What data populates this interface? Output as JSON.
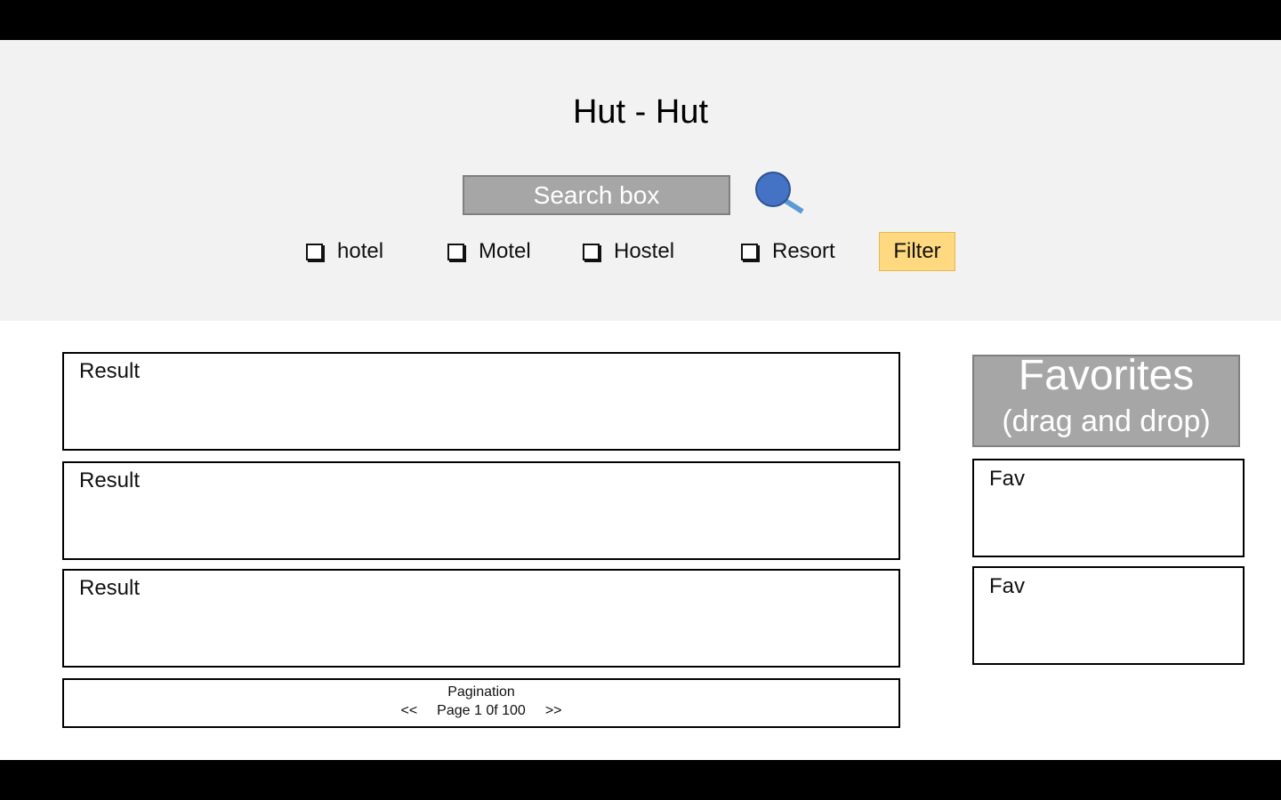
{
  "app": {
    "title": "Hut - Hut"
  },
  "search": {
    "placeholder": "Search box",
    "value": ""
  },
  "filters": [
    {
      "label": "hotel",
      "checked": false
    },
    {
      "label": "Motel",
      "checked": false
    },
    {
      "label": "Hostel",
      "checked": false
    },
    {
      "label": "Resort",
      "checked": false
    }
  ],
  "filter_button": {
    "label": "Filter"
  },
  "results": [
    {
      "label": "Result"
    },
    {
      "label": "Result"
    },
    {
      "label": "Result"
    }
  ],
  "pagination": {
    "label": "Pagination",
    "prev": "<<",
    "page_text": "Page 1 0f 100",
    "next": ">>"
  },
  "favorites": {
    "title": "Favorites",
    "subtitle": "(drag and drop)",
    "items": [
      {
        "label": "Fav"
      },
      {
        "label": "Fav"
      }
    ]
  },
  "icons": {
    "search": "search-icon",
    "checkbox": "checkbox-icon"
  },
  "colors": {
    "header_bg": "#f2f2f2",
    "search_bg": "#a6a6a6",
    "search_icon": "#4472c4",
    "search_handle": "#5b9bd5",
    "filter_bg": "#ffd97f",
    "favorites_bg": "#a6a6a6"
  }
}
